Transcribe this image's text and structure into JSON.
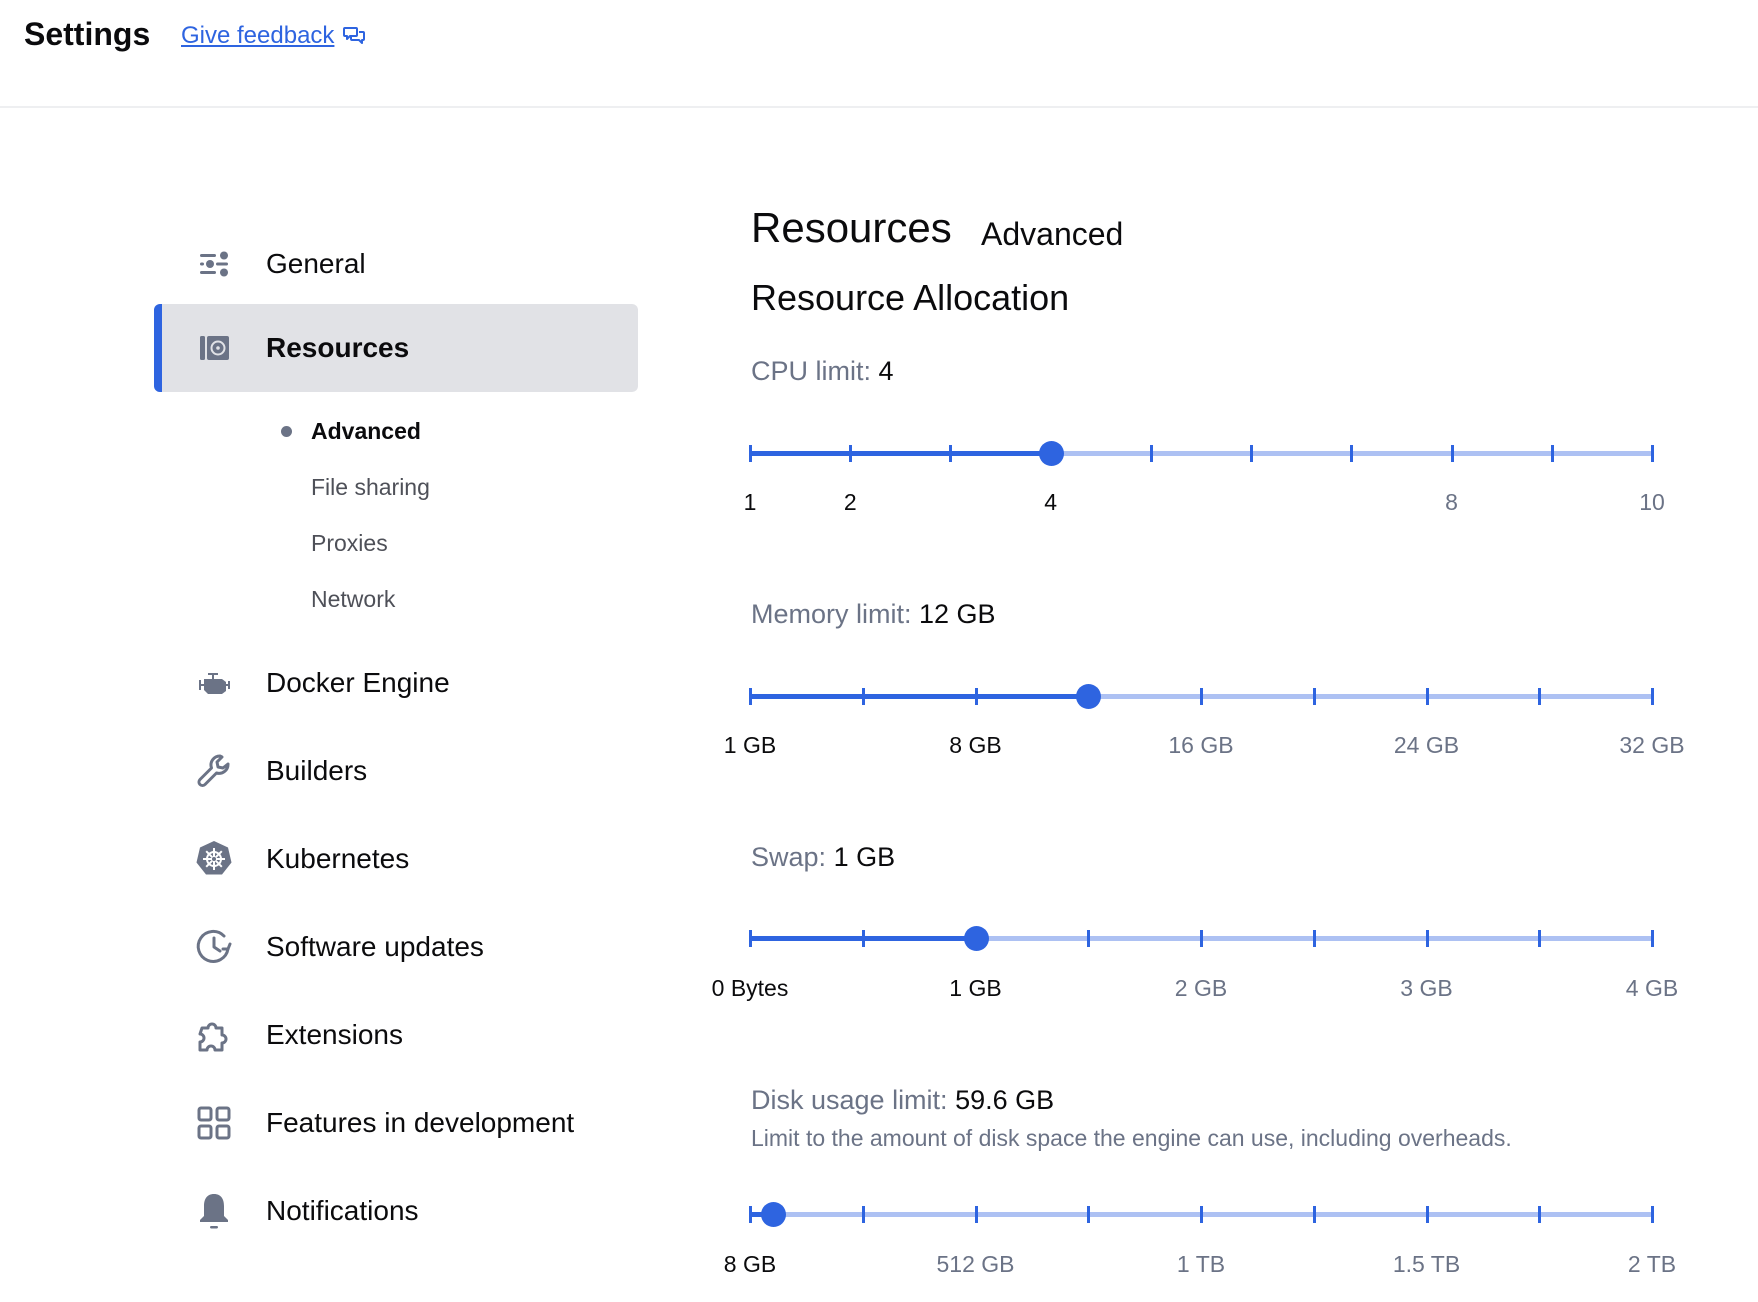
{
  "header": {
    "title": "Settings",
    "feedback_label": "Give feedback",
    "feedback_icon": "chat-bubbles-icon"
  },
  "colors": {
    "accent": "#2e64e0",
    "track_inactive": "#adc1f3",
    "active_nav_bg": "#e1e2e6",
    "muted_text": "#6b7386",
    "icon": "#6b7386"
  },
  "sidebar": {
    "items": [
      {
        "label": "General",
        "icon": "sliders-icon",
        "active": false
      },
      {
        "label": "Resources",
        "icon": "disk-drive-icon",
        "active": true
      },
      {
        "label": "Docker Engine",
        "icon": "engine-icon",
        "active": false
      },
      {
        "label": "Builders",
        "icon": "wrench-icon",
        "active": false
      },
      {
        "label": "Kubernetes",
        "icon": "kubernetes-helm-icon",
        "active": false
      },
      {
        "label": "Software updates",
        "icon": "clock-refresh-icon",
        "active": false
      },
      {
        "label": "Extensions",
        "icon": "puzzle-icon",
        "active": false
      },
      {
        "label": "Features in development",
        "icon": "grid-icon",
        "active": false
      },
      {
        "label": "Notifications",
        "icon": "bell-icon",
        "active": false
      }
    ],
    "sub_items": [
      {
        "label": "Advanced",
        "active": true
      },
      {
        "label": "File sharing",
        "active": false
      },
      {
        "label": "Proxies",
        "active": false
      },
      {
        "label": "Network",
        "active": false
      }
    ]
  },
  "main": {
    "title": "Resources",
    "subtitle": "Advanced",
    "section_title": "Resource Allocation",
    "settings": [
      {
        "key": "cpu",
        "label": "CPU limit:",
        "value_text": "4",
        "min": 1,
        "max": 10,
        "value": 4,
        "tick_count": 10,
        "tick_labels": [
          {
            "text": "1",
            "at": 1
          },
          {
            "text": "2",
            "at": 2
          },
          {
            "text": "4",
            "at": 4
          },
          {
            "text": "8",
            "at": 8
          },
          {
            "text": "10",
            "at": 10
          }
        ]
      },
      {
        "key": "memory",
        "label": "Memory limit:",
        "value_text": "12 GB",
        "min": 0,
        "max": 8,
        "value": 3,
        "tick_count": 9,
        "tick_labels": [
          {
            "text": "1 GB",
            "at": 0
          },
          {
            "text": "8 GB",
            "at": 2
          },
          {
            "text": "16 GB",
            "at": 4
          },
          {
            "text": "24 GB",
            "at": 6
          },
          {
            "text": "32 GB",
            "at": 8
          }
        ]
      },
      {
        "key": "swap",
        "label": "Swap:",
        "value_text": "1 GB",
        "min": 0,
        "max": 8,
        "value": 2,
        "tick_count": 9,
        "tick_labels": [
          {
            "text": "0 Bytes",
            "at": 0
          },
          {
            "text": "1 GB",
            "at": 2
          },
          {
            "text": "2 GB",
            "at": 4
          },
          {
            "text": "3 GB",
            "at": 6
          },
          {
            "text": "4 GB",
            "at": 8
          }
        ]
      },
      {
        "key": "disk",
        "label": "Disk usage limit:",
        "value_text": "59.6 GB",
        "description": "Limit to the amount of disk space the engine can use, including overheads.",
        "min": 8,
        "max": 2048,
        "value": 59.6,
        "tick_count": 9,
        "tick_labels": [
          {
            "text": "8 GB",
            "at": 8
          },
          {
            "text": "512 GB",
            "at": 518
          },
          {
            "text": "1 TB",
            "at": 1028
          },
          {
            "text": "1.5 TB",
            "at": 1538
          },
          {
            "text": "2 TB",
            "at": 2048
          }
        ]
      }
    ]
  }
}
